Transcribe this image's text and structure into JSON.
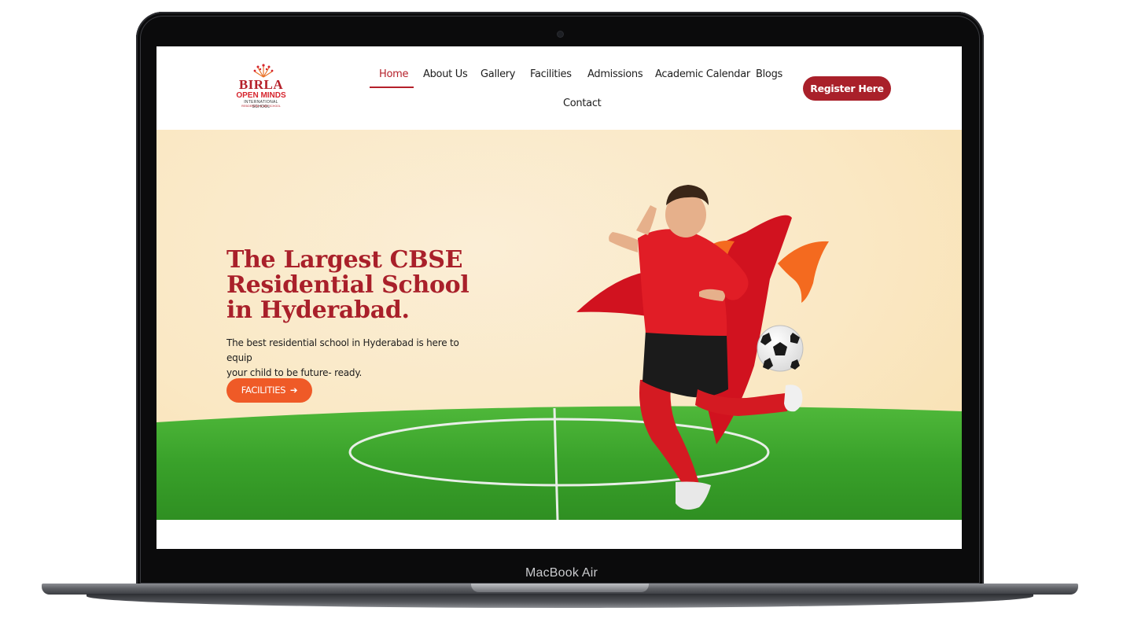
{
  "device": {
    "label": "MacBook Air"
  },
  "logo": {
    "line1": "BIRLA",
    "line2": "OPEN MINDS",
    "line3": "INTERNATIONAL SCHOOL",
    "line4": "RESIDENTIAL & DAY SCHOOL"
  },
  "nav": {
    "items": [
      {
        "label": "Home",
        "active": true
      },
      {
        "label": "About Us"
      },
      {
        "label": "Gallery"
      },
      {
        "label": "Facilities"
      },
      {
        "label": "Admissions"
      },
      {
        "label": "Academic Calendar"
      },
      {
        "label": "Blogs"
      },
      {
        "label": "Contact"
      }
    ],
    "cta_label": "Register Here"
  },
  "hero": {
    "title_lines": [
      "The Largest CBSE",
      "Residential School",
      "in Hyderabad."
    ],
    "subtitle_line1": "The best residential school in Hyderabad is here to equip",
    "subtitle_line2": "your child to be future- ready.",
    "button_label": "FACILITIES",
    "button_icon": "arrow-right-icon"
  },
  "colors": {
    "brand_red": "#a9202a",
    "accent_orange": "#ef5a27",
    "hero_bg": "#fae8c4",
    "grass": "#3ea82c"
  }
}
